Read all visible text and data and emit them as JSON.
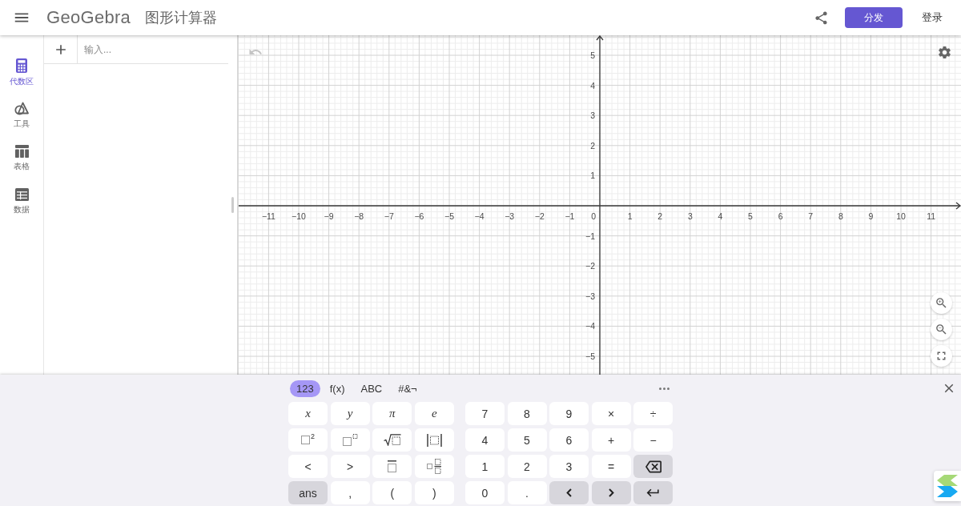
{
  "header": {
    "app_name": "GeoGebra",
    "title": "图形计算器",
    "primary_button": "分发",
    "login_button": "登录"
  },
  "sidebar": {
    "items": [
      {
        "kind": "algebra",
        "label": "代数区",
        "selected": true
      },
      {
        "kind": "tools",
        "label": "工具",
        "selected": false
      },
      {
        "kind": "table",
        "label": "表格",
        "selected": false
      },
      {
        "kind": "data",
        "label": "数据",
        "selected": false
      }
    ]
  },
  "algebra": {
    "input": {
      "placeholder": "输入..."
    }
  },
  "graph": {
    "undo": {
      "disabled": true
    },
    "x_axis": {
      "negative_labels": [
        "−11",
        "−10",
        "−9",
        "−8",
        "−7",
        "−6",
        "−5",
        "−4",
        "−3",
        "−2",
        "−1"
      ],
      "origin_label": "0",
      "positive_labels": [
        "1",
        "2",
        "3",
        "4",
        "5",
        "6",
        "7",
        "8",
        "9",
        "10",
        "11"
      ]
    },
    "y_axis": {
      "positive_labels": [
        "5",
        "4",
        "3",
        "2",
        "1"
      ],
      "negative_labels": [
        "−1",
        "−2",
        "−3",
        "−4",
        "−5"
      ]
    }
  },
  "keyboard": {
    "tabs": [
      {
        "label": "123",
        "selected": true
      },
      {
        "label": "f(x)",
        "selected": false
      },
      {
        "label": "ABC",
        "selected": false
      },
      {
        "label": "#&¬",
        "selected": false
      }
    ],
    "left_keys": [
      [
        {
          "kind": "variable",
          "label": "x"
        },
        {
          "kind": "variable",
          "label": "y"
        },
        {
          "kind": "variable",
          "label": "π"
        },
        {
          "kind": "variable",
          "label": "e"
        }
      ],
      [
        {
          "kind": "squared",
          "label": "2"
        },
        {
          "kind": "power"
        },
        {
          "kind": "root"
        },
        {
          "kind": "abs"
        }
      ],
      [
        {
          "kind": "symbol",
          "label": "<"
        },
        {
          "kind": "symbol",
          "label": ">"
        },
        {
          "kind": "overline"
        },
        {
          "kind": "mixed"
        }
      ],
      [
        {
          "kind": "ans",
          "label": "ans"
        },
        {
          "kind": "symbol",
          "label": ","
        },
        {
          "kind": "symbol",
          "label": "("
        },
        {
          "kind": "symbol",
          "label": ")"
        }
      ]
    ],
    "right_keys": [
      [
        {
          "kind": "symbol",
          "label": "7"
        },
        {
          "kind": "symbol",
          "label": "8"
        },
        {
          "kind": "symbol",
          "label": "9"
        },
        {
          "kind": "symbol",
          "label": "×"
        },
        {
          "kind": "symbol",
          "label": "÷"
        }
      ],
      [
        {
          "kind": "symbol",
          "label": "4"
        },
        {
          "kind": "symbol",
          "label": "5"
        },
        {
          "kind": "symbol",
          "label": "6"
        },
        {
          "kind": "symbol",
          "label": "+"
        },
        {
          "kind": "symbol",
          "label": "−"
        }
      ],
      [
        {
          "kind": "symbol",
          "label": "1"
        },
        {
          "kind": "symbol",
          "label": "2"
        },
        {
          "kind": "symbol",
          "label": "3"
        },
        {
          "kind": "symbol",
          "label": "="
        },
        {
          "kind": "backspace"
        }
      ],
      [
        {
          "kind": "symbol",
          "label": "0"
        },
        {
          "kind": "symbol",
          "label": "."
        },
        {
          "kind": "left"
        },
        {
          "kind": "right"
        },
        {
          "kind": "enter"
        }
      ]
    ]
  }
}
